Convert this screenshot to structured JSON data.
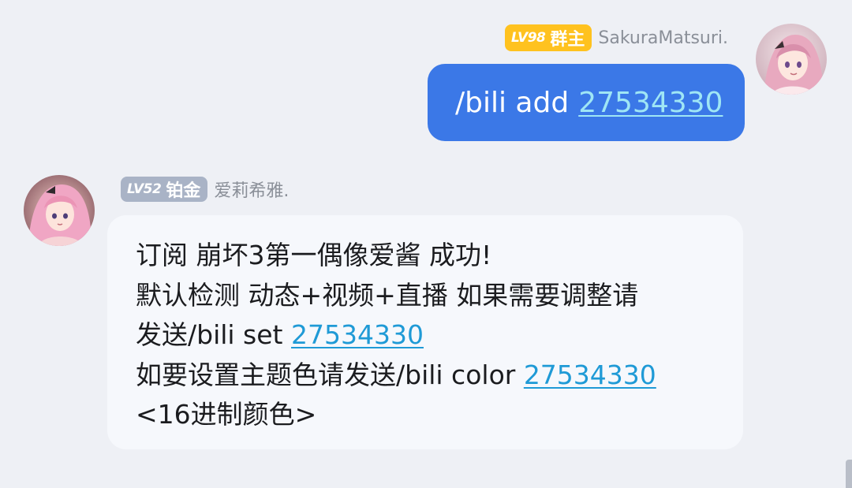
{
  "outgoing": {
    "badge": {
      "level": "LV98",
      "role": "群主"
    },
    "sender": "SakuraMatsuri.",
    "message": {
      "prefix": "/bili add",
      "link": "27534330"
    }
  },
  "incoming": {
    "badge": {
      "level": "LV52",
      "role": "铂金"
    },
    "sender": "爱莉希雅.",
    "lines": {
      "line1": "订阅 崩坏3第一偶像爱酱 成功!",
      "line2": "默认检测 动态+视频+直播 如果需要调整请",
      "line3_prefix": "发送/bili set ",
      "line3_link": "27534330",
      "line4_prefix": "如要设置主题色请发送/bili color ",
      "line4_link": "27534330",
      "line5": "<16进制颜色>"
    }
  },
  "colors": {
    "background": "#eef0f5",
    "outgoing_bubble": "#3b78e7",
    "incoming_bubble": "#f6f8fc",
    "owner_badge": "#ffc21f",
    "member_badge": "#a9b3c6",
    "link_in": "#1f9ad6",
    "link_out": "#9fe6f5"
  },
  "icons": {
    "avatar_right": "anime-girl-avatar",
    "avatar_left": "anime-girl-avatar"
  }
}
